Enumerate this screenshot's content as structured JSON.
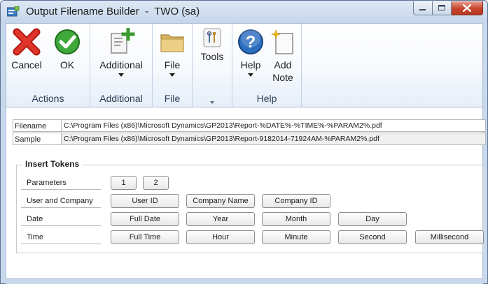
{
  "window": {
    "title": "Output Filename Builder  -  TWO (sa)",
    "caption_buttons": [
      "minimize",
      "maximize",
      "close"
    ]
  },
  "ribbon": {
    "groups": [
      {
        "label": "Actions",
        "buttons": [
          {
            "label": "Cancel",
            "icon": "red-x-icon"
          },
          {
            "label": "OK",
            "icon": "green-check-icon"
          }
        ]
      },
      {
        "label": "Additional",
        "buttons": [
          {
            "label": "Additional",
            "icon": "document-add-icon",
            "dropdown": true
          }
        ]
      },
      {
        "label": "File",
        "buttons": [
          {
            "label": "File",
            "icon": "folder-icon",
            "dropdown": true
          }
        ]
      },
      {
        "label": "",
        "buttons": [
          {
            "label": "Tools",
            "icon": "tools-icon"
          }
        ]
      },
      {
        "label": "Help",
        "buttons": [
          {
            "label": "Help",
            "icon": "help-icon",
            "dropdown": true
          },
          {
            "label": "Add\nNote",
            "line1": "Add",
            "line2": "Note",
            "icon": "add-note-icon"
          }
        ]
      }
    ]
  },
  "fields": {
    "filename": {
      "label": "Filename",
      "value": "C:\\Program Files (x86)\\Microsoft Dynamics\\GP2013\\Report-%DATE%-%TIME%-%PARAM2%.pdf"
    },
    "sample": {
      "label": "Sample",
      "value": "C:\\Program Files (x86)\\Microsoft Dynamics\\GP2013\\Report-9182014-71924AM-%PARAM2%.pdf"
    }
  },
  "tokens": {
    "title": "Insert Tokens",
    "rows": [
      {
        "label": "Parameters",
        "buttons": [
          "1",
          "2"
        ]
      },
      {
        "label": "User and Company",
        "buttons": [
          "User ID",
          "Company Name",
          "Company ID"
        ]
      },
      {
        "label": "Date",
        "buttons": [
          "Full Date",
          "Year",
          "Month",
          "Day"
        ]
      },
      {
        "label": "Time",
        "buttons": [
          "Full Time",
          "Hour",
          "Minute",
          "Second",
          "Millisecond"
        ]
      }
    ]
  },
  "colors": {
    "title_bar": "#c5d6ea",
    "ribbon_text": "#2a3c55",
    "close_button": "#c7442b"
  }
}
